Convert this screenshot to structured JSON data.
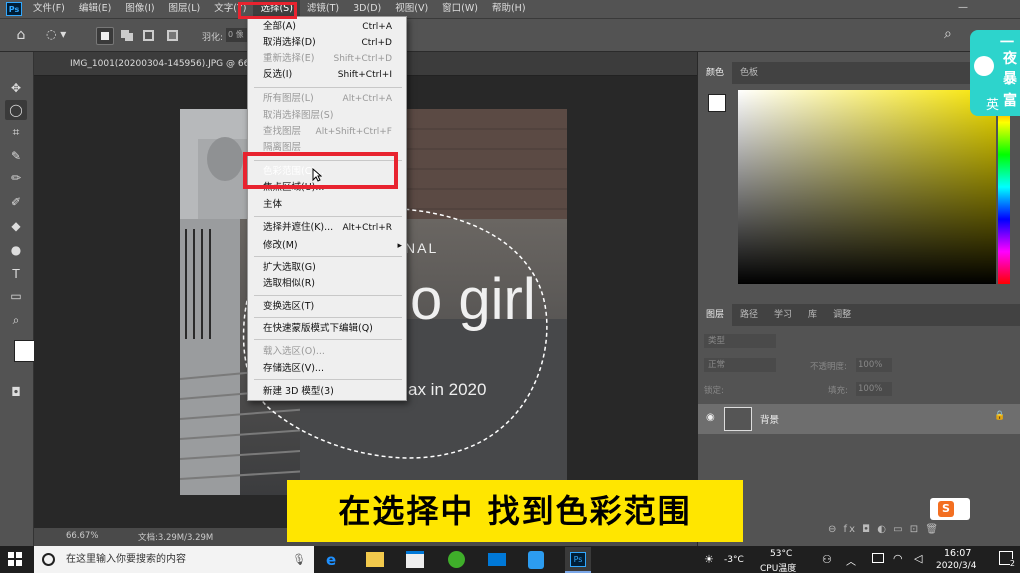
{
  "menubar": {
    "logo": "Ps",
    "items": [
      "文件(F)",
      "编辑(E)",
      "图像(I)",
      "图层(L)",
      "文字(Y)",
      "选择(S)",
      "滤镜(T)",
      "3D(D)",
      "视图(V)",
      "窗口(W)",
      "帮助(H)"
    ],
    "active_index": 5,
    "minimize": "—"
  },
  "options": {
    "feather_label": "羽化:",
    "feather_value": "0 像"
  },
  "document": {
    "tab_title": "IMG_1001(20200304-145956).JPG @ 66.",
    "zoom": "66.67%",
    "doc_size": "文档:3.29M/3.29M",
    "photo_text_nal": "NAL",
    "photo_text_girl": "o girl",
    "photo_text_2020": "ax in 2020"
  },
  "select_menu": {
    "items": [
      {
        "label": "全部(A)",
        "shortcut": "Ctrl+A",
        "disabled": false
      },
      {
        "label": "取消选择(D)",
        "shortcut": "Ctrl+D",
        "disabled": false
      },
      {
        "label": "重新选择(E)",
        "shortcut": "Shift+Ctrl+D",
        "disabled": true
      },
      {
        "label": "反选(I)",
        "shortcut": "Shift+Ctrl+I",
        "disabled": false
      },
      {
        "label": "所有图层(L)",
        "shortcut": "Alt+Ctrl+A",
        "disabled": true
      },
      {
        "label": "取消选择图层(S)",
        "shortcut": "",
        "disabled": true
      },
      {
        "label": "查找图层",
        "shortcut": "Alt+Shift+Ctrl+F",
        "disabled": true
      },
      {
        "label": "隔离图层",
        "shortcut": "",
        "disabled": true
      },
      {
        "label": "色彩范围(C)...",
        "shortcut": "",
        "disabled": false,
        "highlighted": true
      },
      {
        "label": "焦点区域(U)...",
        "shortcut": "",
        "disabled": false
      },
      {
        "label": "主体",
        "shortcut": "",
        "disabled": false
      },
      {
        "label": "选择并遮住(K)...",
        "shortcut": "Alt+Ctrl+R",
        "disabled": false
      },
      {
        "label": "修改(M)",
        "shortcut": "",
        "disabled": false,
        "submenu": true
      },
      {
        "label": "扩大选取(G)",
        "shortcut": "",
        "disabled": false
      },
      {
        "label": "选取相似(R)",
        "shortcut": "",
        "disabled": false
      },
      {
        "label": "变换选区(T)",
        "shortcut": "",
        "disabled": false
      },
      {
        "label": "在快速蒙版模式下编辑(Q)",
        "shortcut": "",
        "disabled": false
      },
      {
        "label": "载入选区(O)...",
        "shortcut": "",
        "disabled": true
      },
      {
        "label": "存储选区(V)...",
        "shortcut": "",
        "disabled": false
      },
      {
        "label": "新建 3D 模型(3)",
        "shortcut": "",
        "disabled": false
      }
    ]
  },
  "color_panel": {
    "tabs": [
      "颜色",
      "色板"
    ]
  },
  "layers_panel": {
    "tabs": [
      "图层",
      "路径",
      "学习",
      "库",
      "调整"
    ],
    "kind_label": "类型",
    "blend_mode": "正常",
    "opacity_label": "不透明度:",
    "opacity_value": "100%",
    "lock_label": "锁定:",
    "fill_label": "填充:",
    "fill_value": "100%",
    "layer_name": "背景",
    "footer_icons": "⊖  fx  ◘  ◐  ▭  ⊡  🗑"
  },
  "caption": "在选择中 找到色彩范围",
  "sticker": {
    "line1": "一",
    "line2": "夜",
    "line3": "暴",
    "line4": "富",
    "ime": "英"
  },
  "taskbar": {
    "search_placeholder": "在这里输入你要搜索的内容",
    "weather": "-3°C",
    "cpu_temp": "53°C",
    "cpu_label": "CPU温度",
    "time": "16:07",
    "date": "2020/3/4",
    "notify_count": "2"
  },
  "colors": {
    "accent_red": "#e8232f",
    "highlight_blue": "#0a64d8",
    "caption_yellow": "#ffe600"
  }
}
